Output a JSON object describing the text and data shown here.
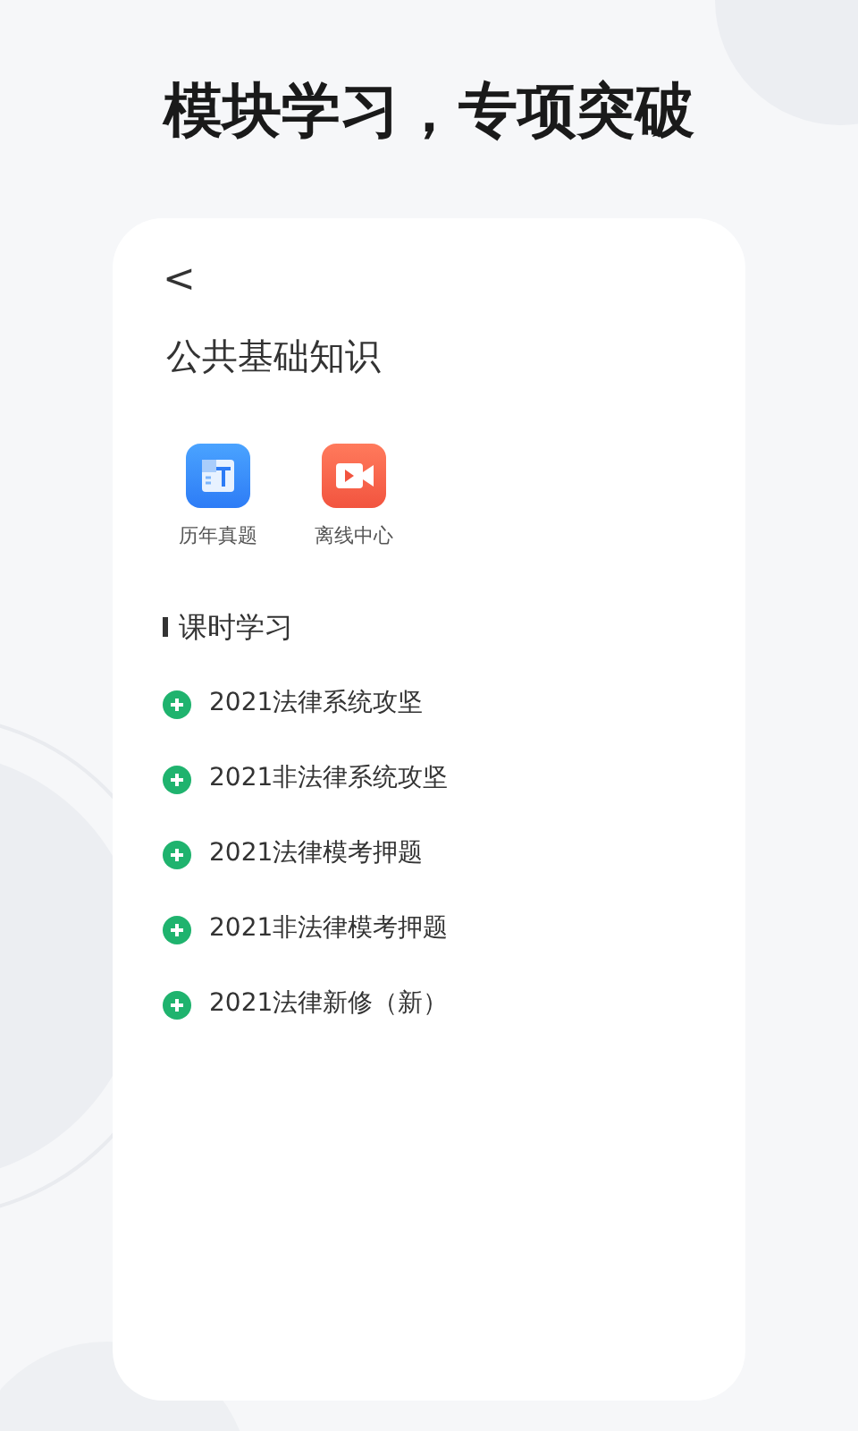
{
  "headline": "模块学习，专项突破",
  "page": {
    "back": "<",
    "title": "公共基础知识"
  },
  "shortcuts": [
    {
      "kind": "questions",
      "label": "历年真题"
    },
    {
      "kind": "video",
      "label": "离线中心"
    }
  ],
  "section": {
    "title": "课时学习"
  },
  "courses": [
    {
      "title": "2021法律系统攻坚"
    },
    {
      "title": "2021非法律系统攻坚"
    },
    {
      "title": "2021法律模考押题"
    },
    {
      "title": "2021非法律模考押题"
    },
    {
      "title": "2021法律新修（新）"
    }
  ]
}
